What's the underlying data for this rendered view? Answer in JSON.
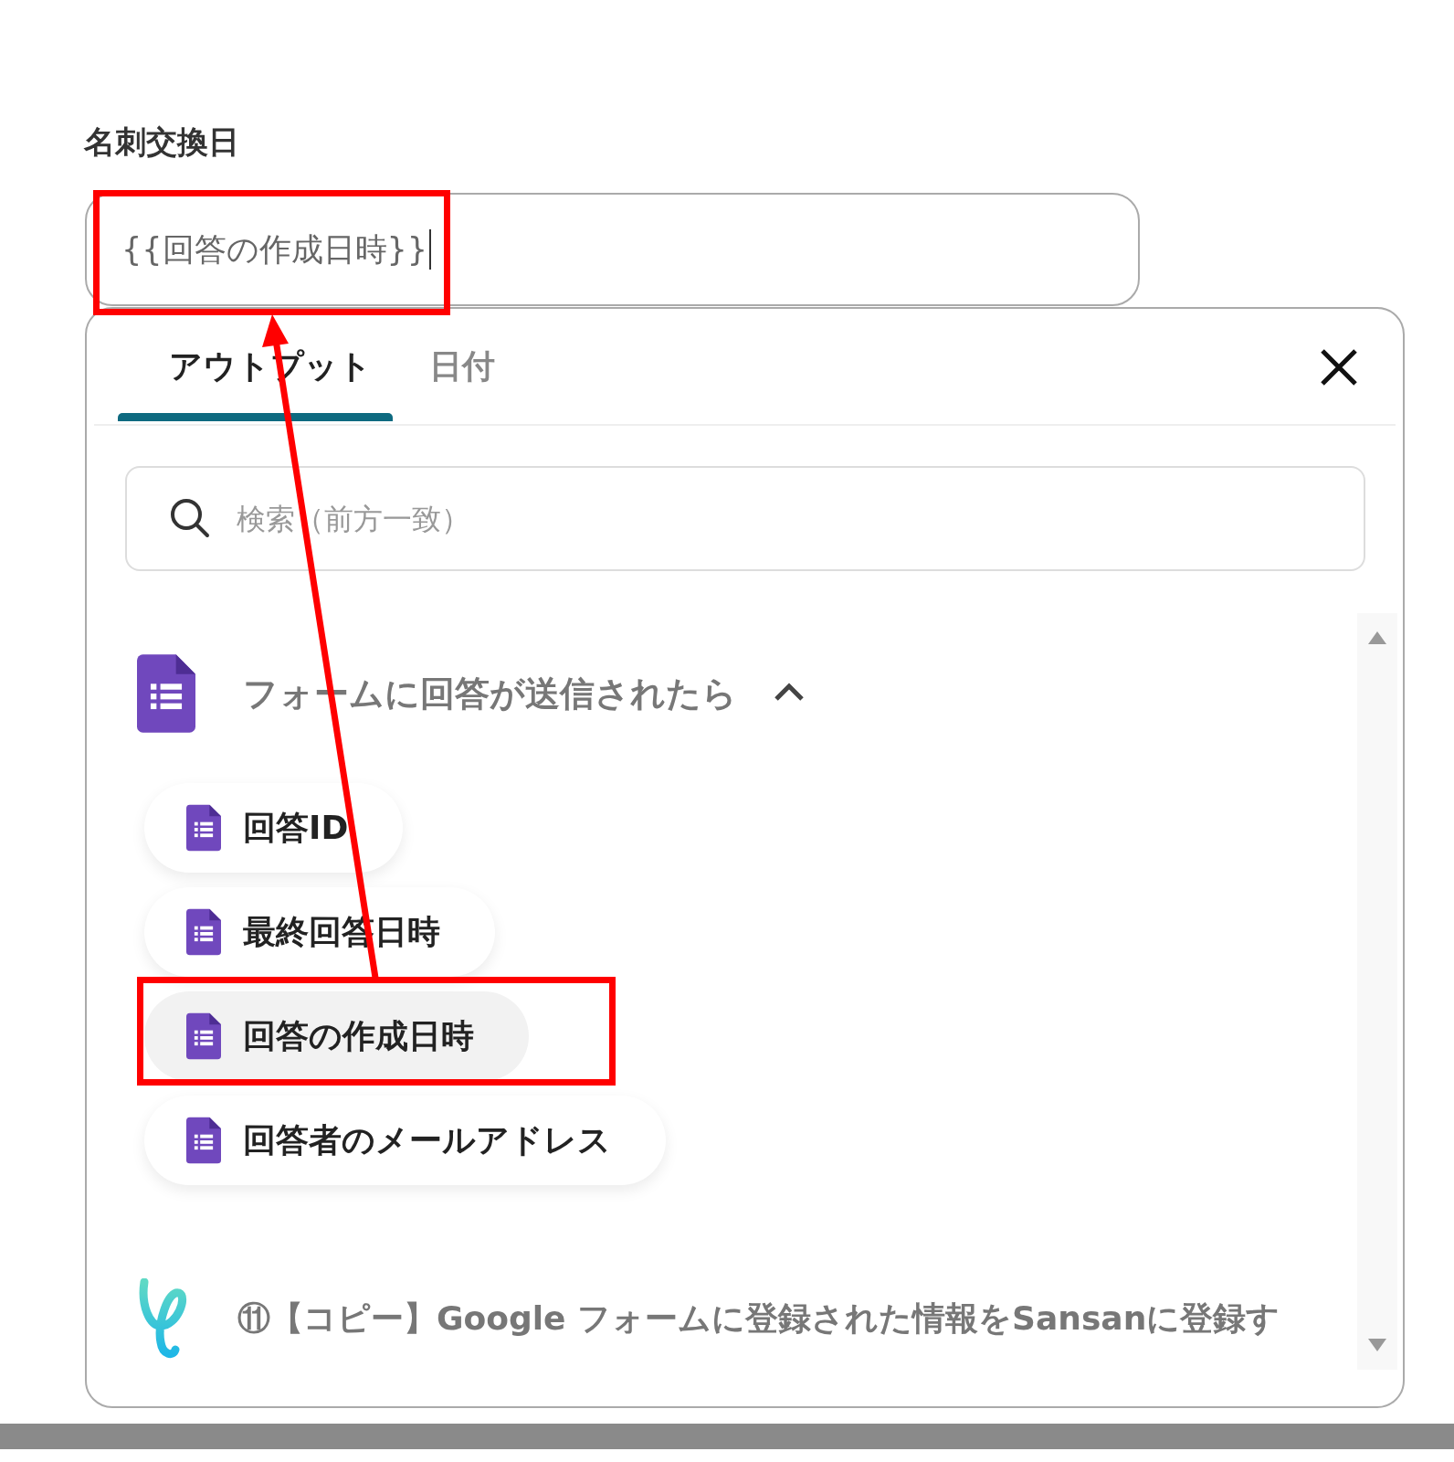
{
  "field": {
    "label": "名刺交換日",
    "value": "{{回答の作成日時}}"
  },
  "tabs": [
    {
      "label": "アウトプット",
      "selected": true
    },
    {
      "label": "日付",
      "selected": false
    }
  ],
  "search": {
    "placeholder": "検索（前方一致）"
  },
  "group": {
    "title": "フォームに回答が送信されたら",
    "expanded": true,
    "items": [
      {
        "label": "回答ID",
        "selected": false
      },
      {
        "label": "最終回答日時",
        "selected": false
      },
      {
        "label": "回答の作成日時",
        "selected": true
      },
      {
        "label": "回答者のメールアドレス",
        "selected": false
      }
    ]
  },
  "flow": {
    "title": "⑪【コピー】Google フォームに登録された情報をSansanに登録す"
  }
}
